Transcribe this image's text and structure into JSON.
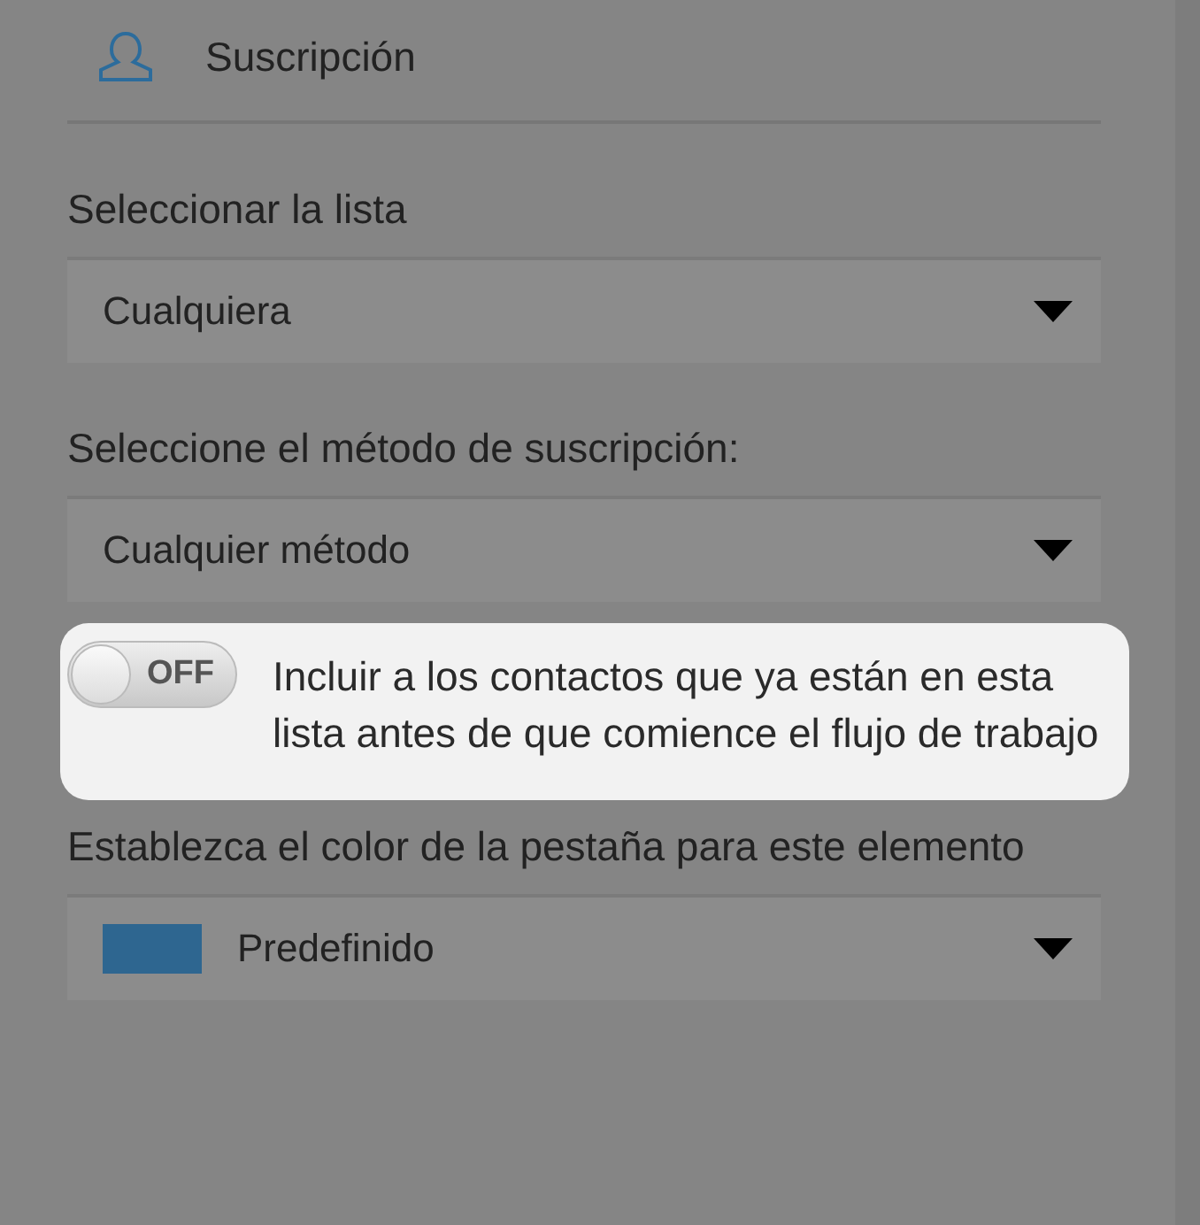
{
  "header": {
    "title": "Suscripción"
  },
  "fields": [
    {
      "kind": "select",
      "label": "Seleccionar la lista",
      "value": "Cualquiera"
    },
    {
      "kind": "select",
      "label": "Seleccione el método de suscripción:",
      "value": "Cualquier método"
    },
    {
      "kind": "toggle",
      "on": false,
      "state_text": "OFF",
      "label": "Incluir a los contactos que ya están en esta lista antes de que comience el flujo de trabajo"
    },
    {
      "kind": "color_select",
      "label": "Establezca el color de la pestaña para este elemento",
      "value": "Predefinido",
      "color": "#2e6690"
    }
  ]
}
